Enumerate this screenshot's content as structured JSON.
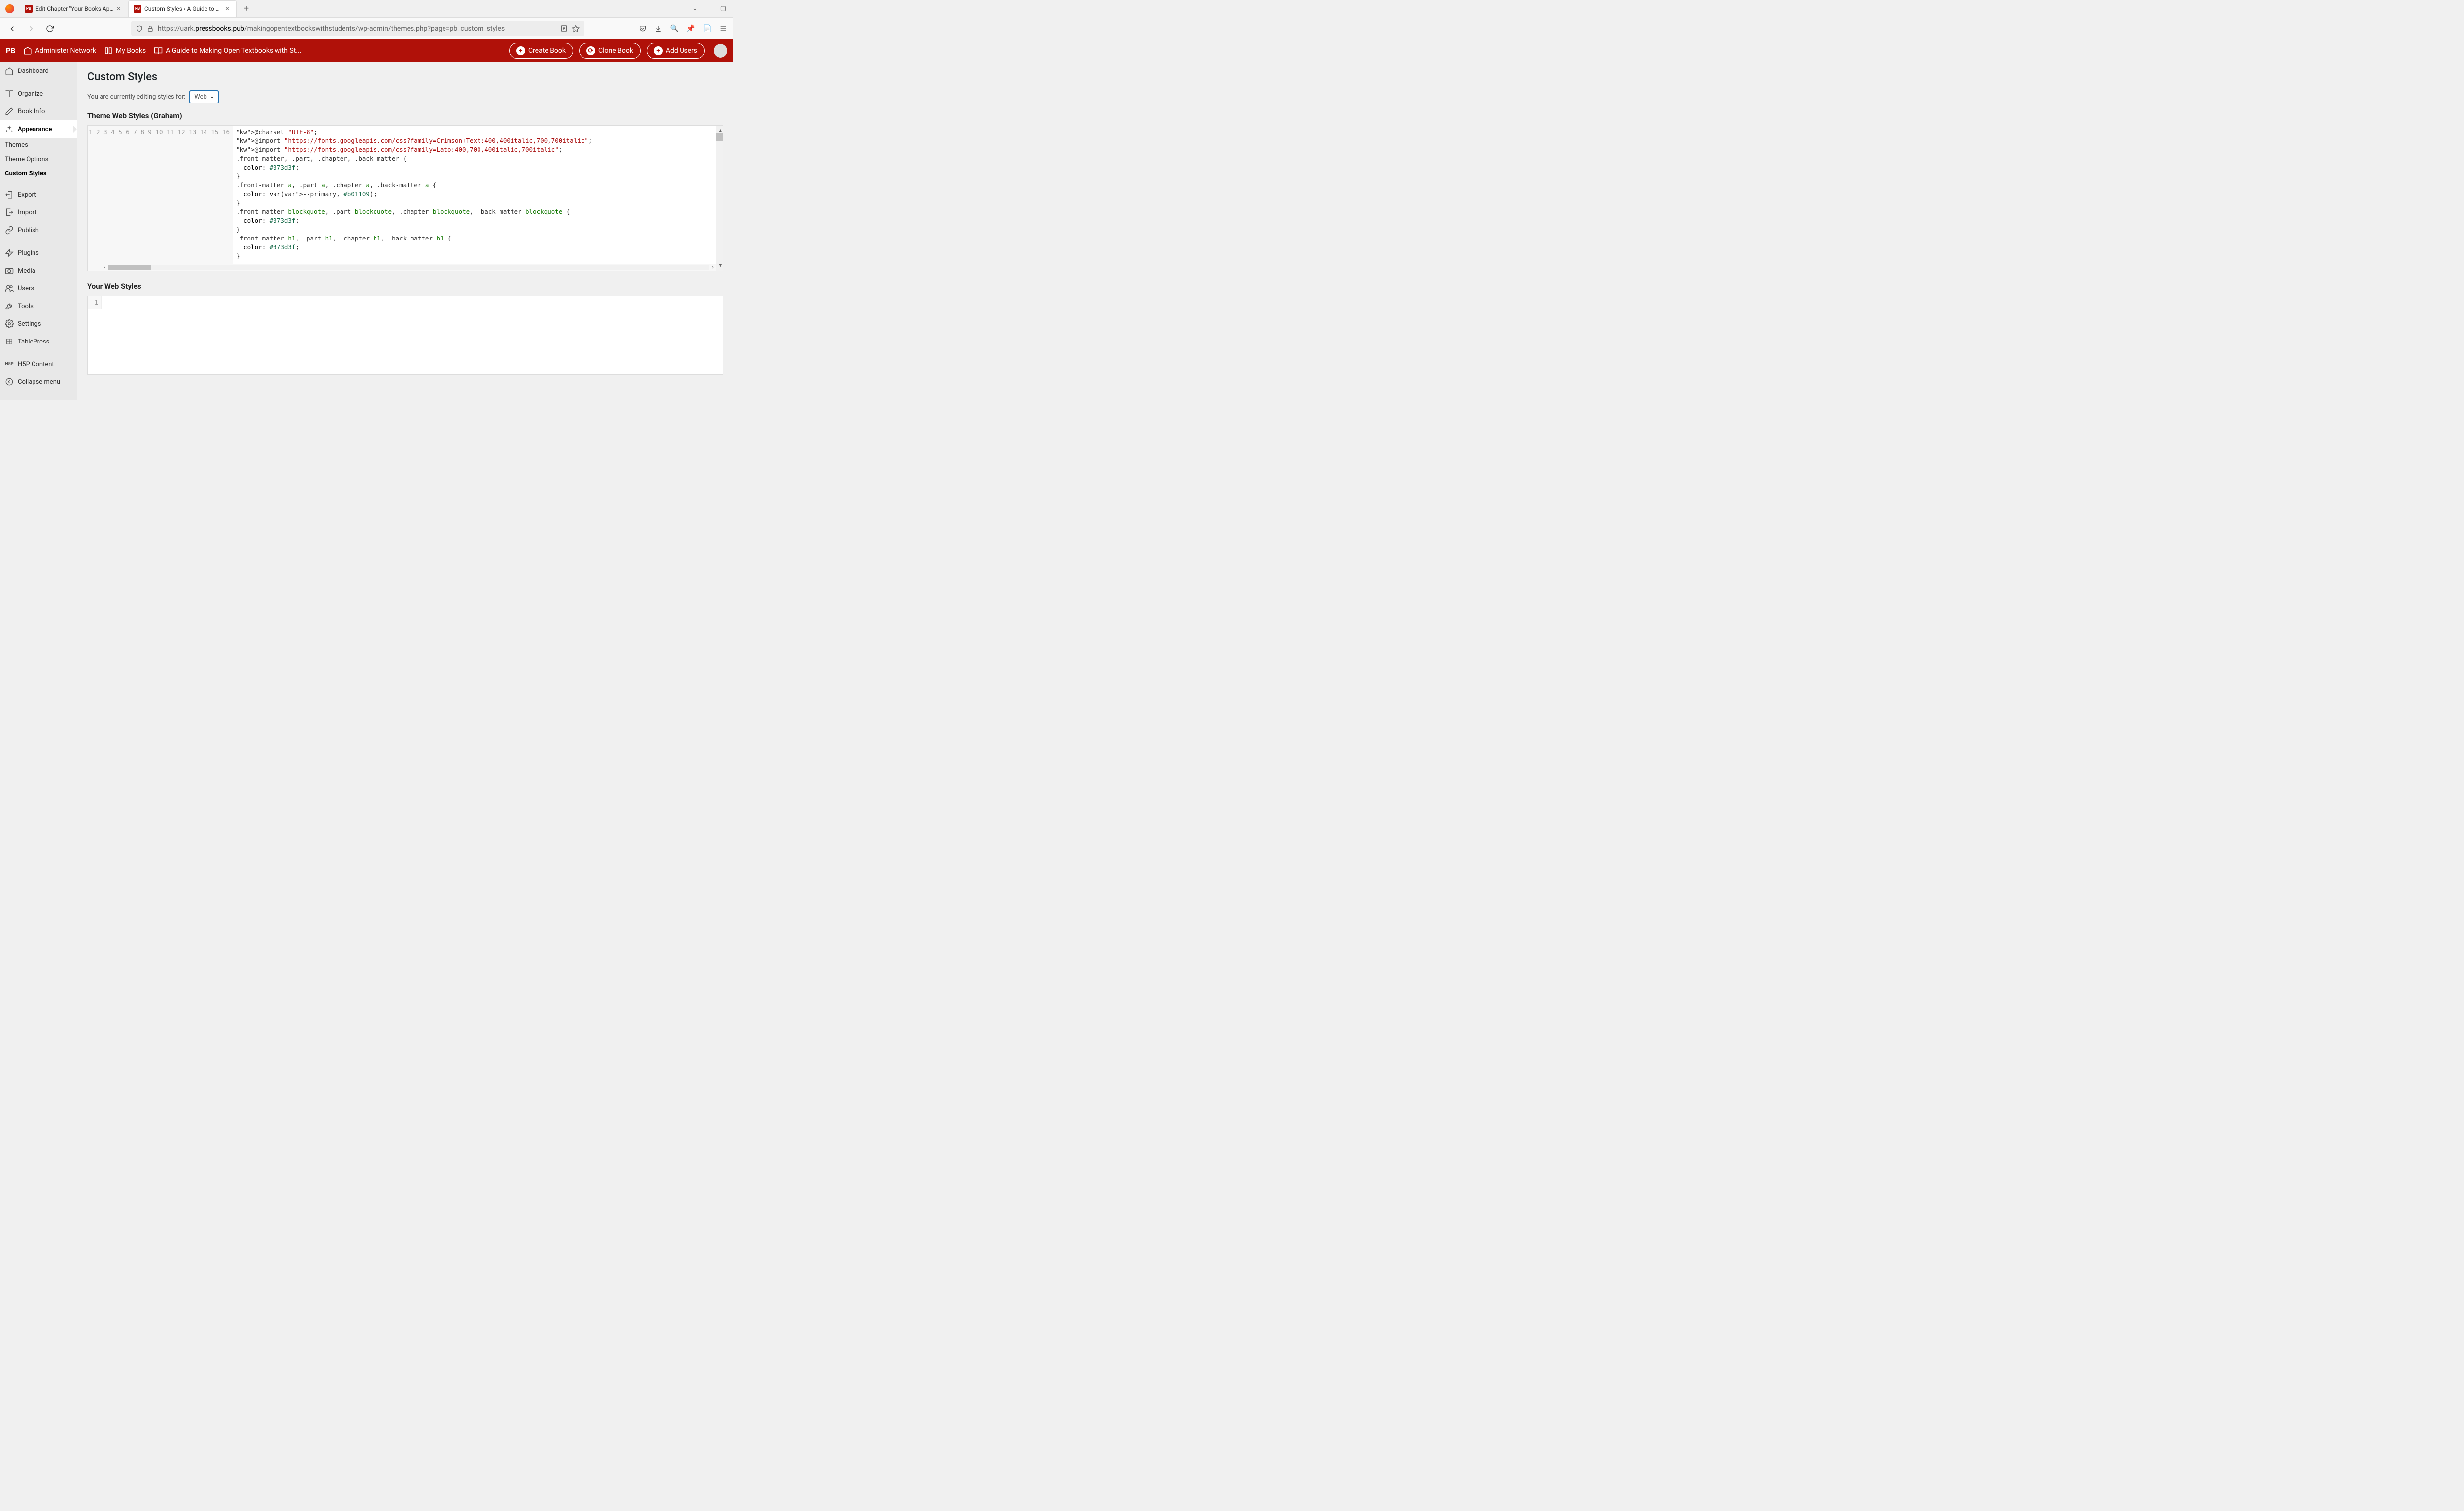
{
  "browser": {
    "tabs": [
      {
        "favicon": "PB",
        "title": "Edit Chapter \"Your Books Appea..."
      },
      {
        "favicon": "PB",
        "title": "Custom Styles ‹ A Guide to Mak..."
      }
    ],
    "url_prefix": "https://uark.",
    "url_domain": "pressbooks.pub",
    "url_path": "/makingopentextbookswithstudents/wp-admin/themes.php?page=pb_custom_styles"
  },
  "appbar": {
    "logo": "PB",
    "links": {
      "administer": "Administer Network",
      "mybooks": "My Books",
      "guide": "A Guide to Making Open Textbooks with St..."
    },
    "buttons": {
      "create": "Create Book",
      "clone": "Clone Book",
      "addusers": "Add Users"
    }
  },
  "sidebar": {
    "dashboard": "Dashboard",
    "organize": "Organize",
    "bookinfo": "Book Info",
    "appearance": "Appearance",
    "themes": "Themes",
    "themeoptions": "Theme Options",
    "customstyles": "Custom Styles",
    "export": "Export",
    "import": "Import",
    "publish": "Publish",
    "plugins": "Plugins",
    "media": "Media",
    "users": "Users",
    "tools": "Tools",
    "settings": "Settings",
    "tablepress": "TablePress",
    "h5p": "H5P Content",
    "collapse": "Collapse menu"
  },
  "main": {
    "title": "Custom Styles",
    "editing_label": "You are currently editing styles for:",
    "select_value": "Web",
    "theme_styles_title": "Theme Web Styles (Graham)",
    "your_styles_title": "Your Web Styles",
    "code_lines": [
      "@charset \"UTF-8\";",
      "@import \"https://fonts.googleapis.com/css?family=Crimson+Text:400,400italic,700,700italic\";",
      "@import \"https://fonts.googleapis.com/css?family=Lato:400,700,400italic,700italic\";",
      ".front-matter, .part, .chapter, .back-matter {",
      "  color: #373d3f;",
      "}",
      ".front-matter a, .part a, .chapter a, .back-matter a {",
      "  color: var(--primary, #b01109);",
      "}",
      ".front-matter blockquote, .part blockquote, .chapter blockquote, .back-matter blockquote {",
      "  color: #373d3f;",
      "}",
      ".front-matter h1, .part h1, .chapter h1, .back-matter h1 {",
      "  color: #373d3f;",
      "}",
      ""
    ]
  }
}
